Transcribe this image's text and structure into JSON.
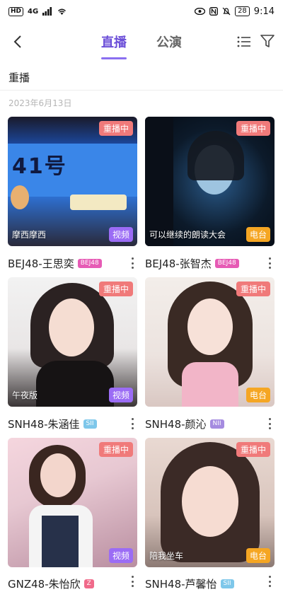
{
  "status": {
    "left_icons": [
      "HD",
      "4G"
    ],
    "battery": "28",
    "time": "9:14"
  },
  "nav": {
    "tabs": [
      "直播",
      "公演"
    ]
  },
  "section": {
    "title": "重播",
    "date": "2023年6月13日"
  },
  "cards": [
    {
      "live": "重播中",
      "caption": "摩西摩西",
      "type": "视频",
      "name": "BEJ48-王思奕",
      "team": "BEJ48",
      "team_color": "#e65bb5"
    },
    {
      "live": "重播中",
      "caption": "可以继续的朗读大会",
      "type": "电台",
      "name": "BEJ48-张智杰",
      "team": "BEJ48",
      "team_color": "#e65bb5"
    },
    {
      "live": "重播中",
      "caption": "午夜版",
      "type": "视频",
      "name": "SNH48-朱涵佳",
      "team": "SII",
      "team_color": "#7ec7ea"
    },
    {
      "live": "重播中",
      "caption": "",
      "type": "电台",
      "name": "SNH48-颜沁",
      "team": "NII",
      "team_color": "#a58be0"
    },
    {
      "live": "重播中",
      "caption": "",
      "type": "视频",
      "name": "GNZ48-朱怡欣",
      "team": "Z",
      "team_color": "#f06a8a"
    },
    {
      "live": "重播中",
      "caption": "陪我坐车",
      "type": "电台",
      "name": "SNH48-芦馨怡",
      "team": "SII",
      "team_color": "#7ec7ea"
    }
  ],
  "colors": {
    "accent": "#6c4fd8",
    "live_badge": "#f07a7a",
    "video_badge": "#9b6cf5",
    "radio_badge": "#f5a623"
  }
}
